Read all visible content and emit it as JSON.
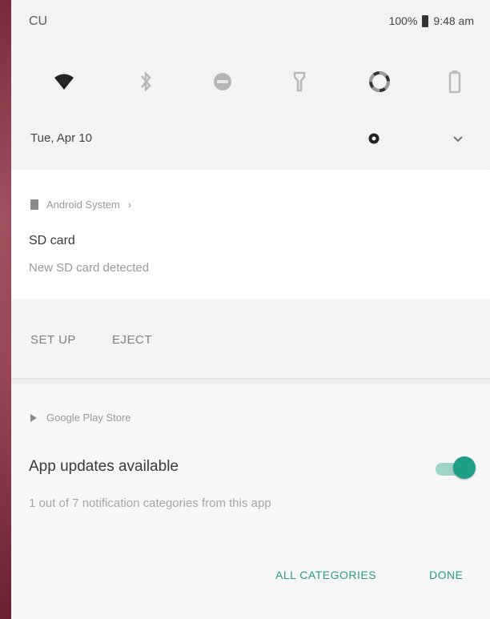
{
  "status_bar": {
    "carrier": "CU",
    "battery": "100%",
    "time": "9:48 am"
  },
  "quick_settings": {
    "tiles": [
      {
        "name": "wifi-icon",
        "icon": "wifi"
      },
      {
        "name": "bluetooth-icon",
        "icon": "bluetooth"
      },
      {
        "name": "do-not-disturb-icon",
        "icon": "dnd"
      },
      {
        "name": "flashlight-icon",
        "icon": "flashlight"
      },
      {
        "name": "auto-rotate-icon",
        "icon": "rotate"
      },
      {
        "name": "battery-saver-icon",
        "icon": "battery"
      }
    ],
    "date": "Tue, Apr 10"
  },
  "notifications": [
    {
      "app": "Android System",
      "app_suffix": "›",
      "title": "SD card",
      "text": "New SD card detected",
      "actions": [
        "SET UP",
        "EJECT"
      ]
    },
    {
      "app": "Google Play Store",
      "title": "App updates available",
      "text": "1 out of 7 notification categories from this app",
      "toggle_on": true,
      "actions": [
        "ALL CATEGORIES",
        "DONE"
      ]
    }
  ],
  "colors": {
    "accent": "#1f9e86",
    "accent_light": "#9fd3c8"
  }
}
